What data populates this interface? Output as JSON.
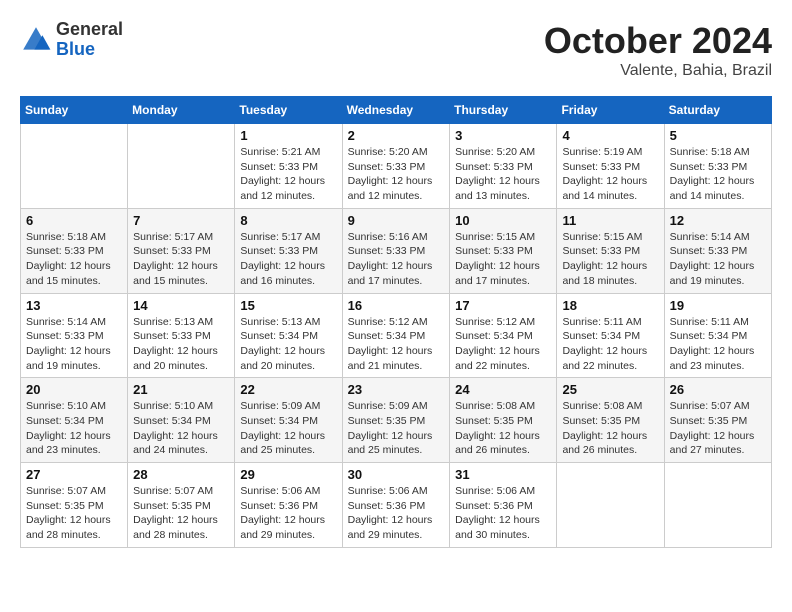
{
  "logo": {
    "general": "General",
    "blue": "Blue"
  },
  "title": {
    "month": "October 2024",
    "location": "Valente, Bahia, Brazil"
  },
  "headers": [
    "Sunday",
    "Monday",
    "Tuesday",
    "Wednesday",
    "Thursday",
    "Friday",
    "Saturday"
  ],
  "weeks": [
    [
      {
        "day": "",
        "info": ""
      },
      {
        "day": "",
        "info": ""
      },
      {
        "day": "1",
        "info": "Sunrise: 5:21 AM\nSunset: 5:33 PM\nDaylight: 12 hours and 12 minutes."
      },
      {
        "day": "2",
        "info": "Sunrise: 5:20 AM\nSunset: 5:33 PM\nDaylight: 12 hours and 12 minutes."
      },
      {
        "day": "3",
        "info": "Sunrise: 5:20 AM\nSunset: 5:33 PM\nDaylight: 12 hours and 13 minutes."
      },
      {
        "day": "4",
        "info": "Sunrise: 5:19 AM\nSunset: 5:33 PM\nDaylight: 12 hours and 14 minutes."
      },
      {
        "day": "5",
        "info": "Sunrise: 5:18 AM\nSunset: 5:33 PM\nDaylight: 12 hours and 14 minutes."
      }
    ],
    [
      {
        "day": "6",
        "info": "Sunrise: 5:18 AM\nSunset: 5:33 PM\nDaylight: 12 hours and 15 minutes."
      },
      {
        "day": "7",
        "info": "Sunrise: 5:17 AM\nSunset: 5:33 PM\nDaylight: 12 hours and 15 minutes."
      },
      {
        "day": "8",
        "info": "Sunrise: 5:17 AM\nSunset: 5:33 PM\nDaylight: 12 hours and 16 minutes."
      },
      {
        "day": "9",
        "info": "Sunrise: 5:16 AM\nSunset: 5:33 PM\nDaylight: 12 hours and 17 minutes."
      },
      {
        "day": "10",
        "info": "Sunrise: 5:15 AM\nSunset: 5:33 PM\nDaylight: 12 hours and 17 minutes."
      },
      {
        "day": "11",
        "info": "Sunrise: 5:15 AM\nSunset: 5:33 PM\nDaylight: 12 hours and 18 minutes."
      },
      {
        "day": "12",
        "info": "Sunrise: 5:14 AM\nSunset: 5:33 PM\nDaylight: 12 hours and 19 minutes."
      }
    ],
    [
      {
        "day": "13",
        "info": "Sunrise: 5:14 AM\nSunset: 5:33 PM\nDaylight: 12 hours and 19 minutes."
      },
      {
        "day": "14",
        "info": "Sunrise: 5:13 AM\nSunset: 5:33 PM\nDaylight: 12 hours and 20 minutes."
      },
      {
        "day": "15",
        "info": "Sunrise: 5:13 AM\nSunset: 5:34 PM\nDaylight: 12 hours and 20 minutes."
      },
      {
        "day": "16",
        "info": "Sunrise: 5:12 AM\nSunset: 5:34 PM\nDaylight: 12 hours and 21 minutes."
      },
      {
        "day": "17",
        "info": "Sunrise: 5:12 AM\nSunset: 5:34 PM\nDaylight: 12 hours and 22 minutes."
      },
      {
        "day": "18",
        "info": "Sunrise: 5:11 AM\nSunset: 5:34 PM\nDaylight: 12 hours and 22 minutes."
      },
      {
        "day": "19",
        "info": "Sunrise: 5:11 AM\nSunset: 5:34 PM\nDaylight: 12 hours and 23 minutes."
      }
    ],
    [
      {
        "day": "20",
        "info": "Sunrise: 5:10 AM\nSunset: 5:34 PM\nDaylight: 12 hours and 23 minutes."
      },
      {
        "day": "21",
        "info": "Sunrise: 5:10 AM\nSunset: 5:34 PM\nDaylight: 12 hours and 24 minutes."
      },
      {
        "day": "22",
        "info": "Sunrise: 5:09 AM\nSunset: 5:34 PM\nDaylight: 12 hours and 25 minutes."
      },
      {
        "day": "23",
        "info": "Sunrise: 5:09 AM\nSunset: 5:35 PM\nDaylight: 12 hours and 25 minutes."
      },
      {
        "day": "24",
        "info": "Sunrise: 5:08 AM\nSunset: 5:35 PM\nDaylight: 12 hours and 26 minutes."
      },
      {
        "day": "25",
        "info": "Sunrise: 5:08 AM\nSunset: 5:35 PM\nDaylight: 12 hours and 26 minutes."
      },
      {
        "day": "26",
        "info": "Sunrise: 5:07 AM\nSunset: 5:35 PM\nDaylight: 12 hours and 27 minutes."
      }
    ],
    [
      {
        "day": "27",
        "info": "Sunrise: 5:07 AM\nSunset: 5:35 PM\nDaylight: 12 hours and 28 minutes."
      },
      {
        "day": "28",
        "info": "Sunrise: 5:07 AM\nSunset: 5:35 PM\nDaylight: 12 hours and 28 minutes."
      },
      {
        "day": "29",
        "info": "Sunrise: 5:06 AM\nSunset: 5:36 PM\nDaylight: 12 hours and 29 minutes."
      },
      {
        "day": "30",
        "info": "Sunrise: 5:06 AM\nSunset: 5:36 PM\nDaylight: 12 hours and 29 minutes."
      },
      {
        "day": "31",
        "info": "Sunrise: 5:06 AM\nSunset: 5:36 PM\nDaylight: 12 hours and 30 minutes."
      },
      {
        "day": "",
        "info": ""
      },
      {
        "day": "",
        "info": ""
      }
    ]
  ]
}
